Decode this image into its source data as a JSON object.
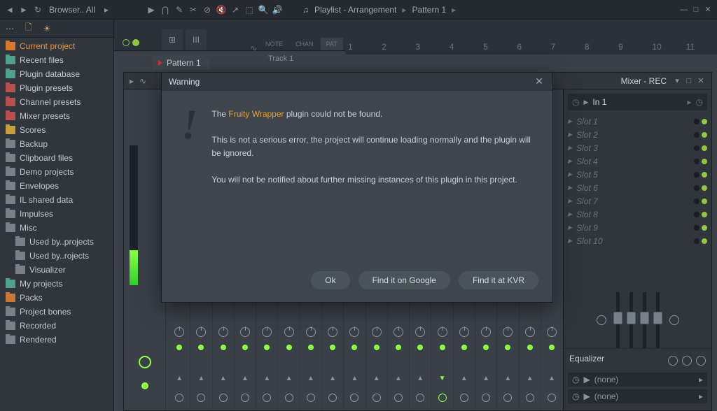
{
  "topbar": {
    "browser_label": "Browser..  All"
  },
  "playlist": {
    "title": "Playlist - Arrangement",
    "pattern": "Pattern 1",
    "track_label": "Track 1",
    "tabs": {
      "note": "NOTE",
      "chan": "CHAN",
      "pat": "PAT"
    },
    "ruler": [
      "1",
      "2",
      "3",
      "4",
      "5",
      "6",
      "7",
      "8",
      "9",
      "10",
      "11"
    ]
  },
  "pattern_tab": "Pattern 1",
  "sidebar": {
    "items": [
      {
        "label": "Current project",
        "cls": "orange",
        "special": true
      },
      {
        "label": "Recent files",
        "cls": "teal"
      },
      {
        "label": "Plugin database",
        "cls": "teal"
      },
      {
        "label": "Plugin presets",
        "cls": "red"
      },
      {
        "label": "Channel presets",
        "cls": "red"
      },
      {
        "label": "Mixer presets",
        "cls": "red"
      },
      {
        "label": "Scores",
        "cls": "yellow"
      },
      {
        "label": "Backup",
        "cls": "grey"
      },
      {
        "label": "Clipboard files",
        "cls": "grey"
      },
      {
        "label": "Demo projects",
        "cls": "grey"
      },
      {
        "label": "Envelopes",
        "cls": "grey"
      },
      {
        "label": "IL shared data",
        "cls": "grey"
      },
      {
        "label": "Impulses",
        "cls": "grey"
      },
      {
        "label": "Misc",
        "cls": "grey"
      },
      {
        "label": "Used by..projects",
        "cls": "grey",
        "sub": true
      },
      {
        "label": "Used by..rojects",
        "cls": "grey",
        "sub": true
      },
      {
        "label": "Visualizer",
        "cls": "grey",
        "sub": true
      },
      {
        "label": "My projects",
        "cls": "teal"
      },
      {
        "label": "Packs",
        "cls": "orange"
      },
      {
        "label": "Project bones",
        "cls": "grey"
      },
      {
        "label": "Recorded",
        "cls": "grey"
      },
      {
        "label": "Rendered",
        "cls": "grey"
      }
    ]
  },
  "mixer": {
    "title": "Mixer - REC",
    "view": "Wide",
    "input": "In 1",
    "slots": [
      "Slot 1",
      "Slot 2",
      "Slot 3",
      "Slot 4",
      "Slot 5",
      "Slot 6",
      "Slot 7",
      "Slot 8",
      "Slot 9",
      "Slot 10"
    ],
    "eq_label": "Equalizer",
    "out_none": "(none)"
  },
  "dialog": {
    "title": "Warning",
    "p1a": "The ",
    "p1_plugin": "Fruity Wrapper",
    "p1b": " plugin could not be found.",
    "p2": "This is not a serious error, the project will continue loading normally and the plugin will be ignored.",
    "p3": "You will not be notified about further missing instances of this plugin in this project.",
    "btn_ok": "Ok",
    "btn_google": "Find it on Google",
    "btn_kvr": "Find it at KVR"
  }
}
